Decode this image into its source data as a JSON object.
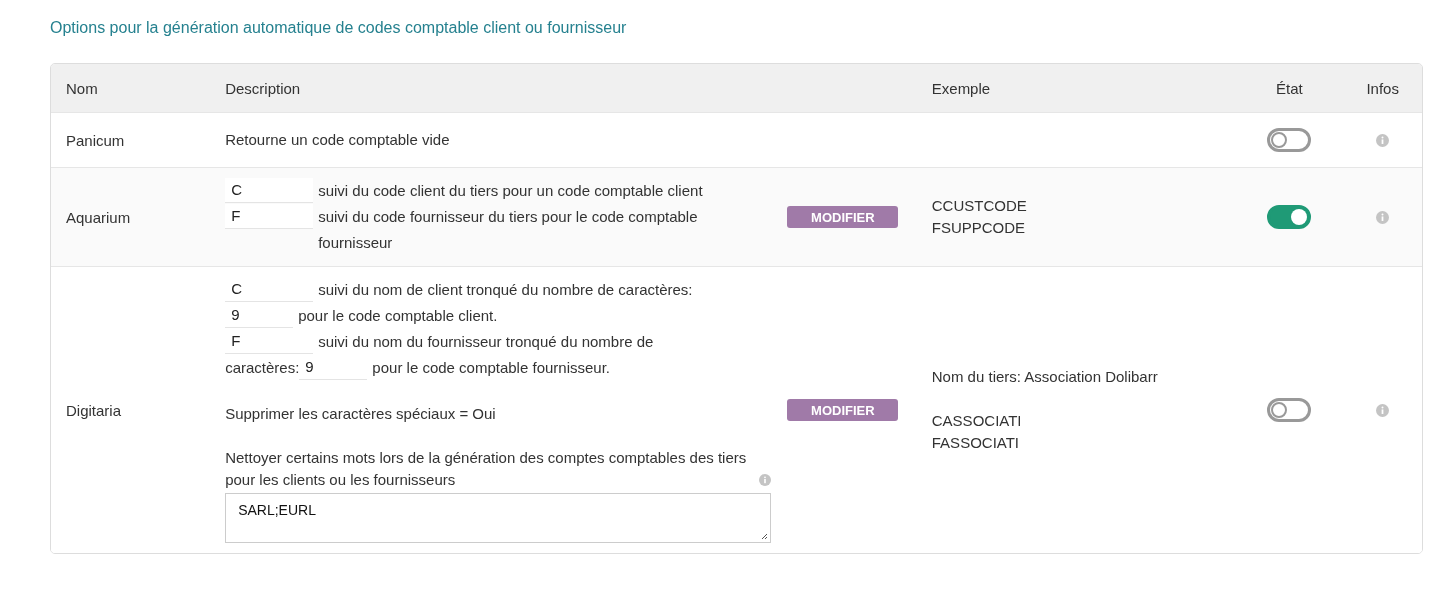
{
  "title": "Options pour la génération automatique de codes comptable client ou fournisseur",
  "columns": [
    "Nom",
    "Description",
    "Exemple",
    "État",
    "Infos"
  ],
  "rows": [
    {
      "name": "Panicum",
      "description": [
        {
          "kind": "line",
          "parts": [
            {
              "kind": "text",
              "text": "Retourne un code comptable vide"
            }
          ]
        }
      ],
      "examples": [],
      "on": false
    },
    {
      "name": "Aquarium",
      "description": [
        {
          "kind": "line",
          "parts": [
            {
              "kind": "input",
              "value": "C"
            },
            {
              "kind": "text",
              "text": "suivi du code client du tiers pour un code comptable client"
            }
          ]
        },
        {
          "kind": "line",
          "parts": [
            {
              "kind": "input",
              "value": "F"
            },
            {
              "kind": "text",
              "text": "suivi du code fournisseur du tiers pour le code comptable fournisseur"
            }
          ]
        }
      ],
      "button": "MODIFIER",
      "examples": [
        [
          "CCUSTCODE",
          "FSUPPCODE"
        ]
      ],
      "on": true
    },
    {
      "name": "Digitaria",
      "description": [
        {
          "kind": "line",
          "parts": [
            {
              "kind": "input",
              "value": "C"
            },
            {
              "kind": "text",
              "text": "suivi du nom de client tronqué du nombre de caractères:"
            }
          ]
        },
        {
          "kind": "line",
          "parts": [
            {
              "kind": "short-input",
              "value": "9"
            },
            {
              "kind": "text",
              "text": "pour le code comptable client."
            }
          ]
        },
        {
          "kind": "line",
          "parts": [
            {
              "kind": "input",
              "value": "F"
            },
            {
              "kind": "text",
              "text": "suivi du nom du fournisseur tronqué du nombre de"
            }
          ]
        },
        {
          "kind": "line",
          "parts": [
            {
              "kind": "text",
              "text": "caractères:"
            },
            {
              "kind": "short-input",
              "value": "9"
            },
            {
              "kind": "text",
              "text": "pour le code comptable fournisseur."
            }
          ]
        },
        {
          "kind": "paragraph",
          "text": "Supprimer les caractères spéciaux = Oui"
        },
        {
          "kind": "paragraph",
          "text": "Nettoyer certains mots lors de la génération des comptes comptables des tiers pour les clients ou les fournisseurs",
          "info": true
        },
        {
          "kind": "textarea",
          "value": "SARL;EURL"
        }
      ],
      "button": "MODIFIER",
      "examples": [
        [
          "Nom du tiers: Association Dolibarr"
        ],
        [
          "CASSOCIATI",
          "FASSOCIATI"
        ]
      ],
      "on": false
    }
  ]
}
